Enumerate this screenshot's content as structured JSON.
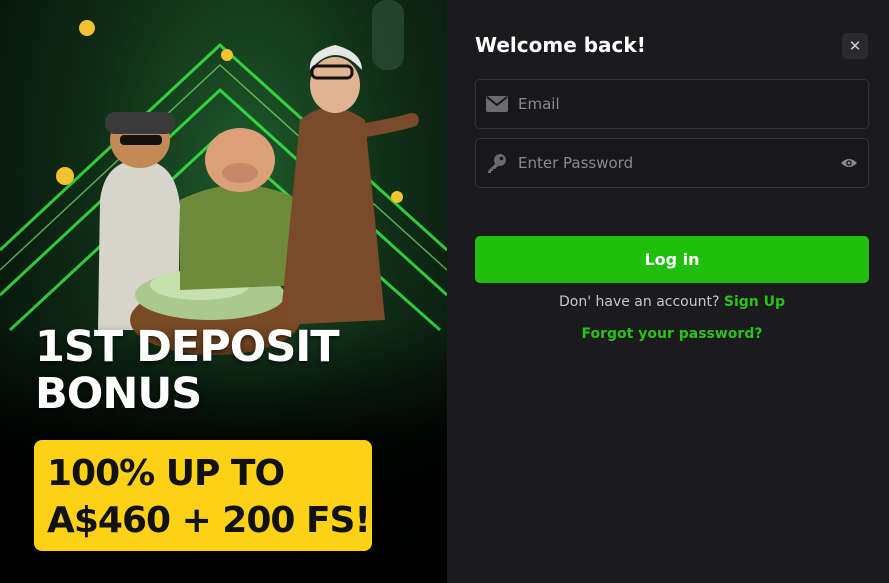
{
  "promo": {
    "title_line1": "1ST DEPOSIT",
    "title_line2": "BONUS",
    "offer_line1": "100% UP TO",
    "offer_line2": "A$460 + 200 FS!",
    "accent_color": "#fcd116"
  },
  "login": {
    "heading": "Welcome back!",
    "close_icon": "close-icon",
    "email": {
      "placeholder": "Email",
      "value": "",
      "icon": "envelope-icon"
    },
    "password": {
      "placeholder": "Enter Password",
      "value": "",
      "icon": "key-icon",
      "toggle_icon": "eye-icon"
    },
    "submit_label": "Log in",
    "signup_prompt": "Don' have an account?",
    "signup_link": "Sign Up",
    "forgot_link": "Forgot your password?",
    "brand_color": "#1fbf0b"
  }
}
